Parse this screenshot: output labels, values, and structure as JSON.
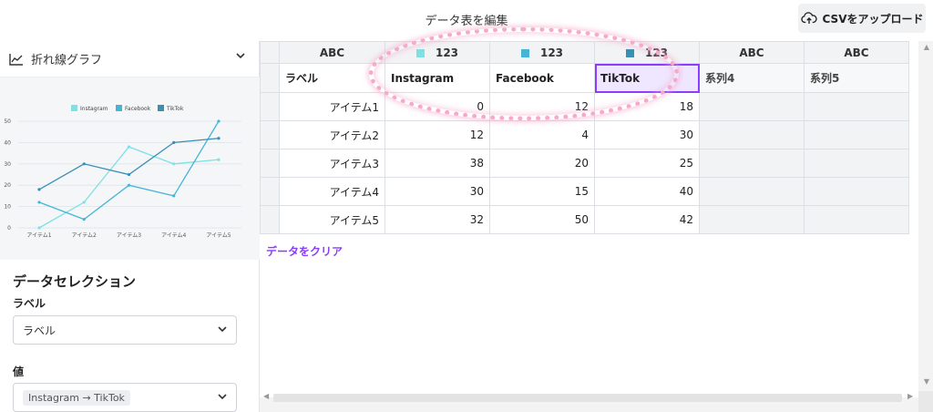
{
  "header": {
    "title": "データ表を編集",
    "csv_button": "CSVをアップロード"
  },
  "sidebar": {
    "chart_type": "折れ線グラフ",
    "section_title": "データセレクション",
    "label_title": "ラベル",
    "label_value": "ラベル",
    "value_title": "値",
    "value_value": "Instagram → TikTok"
  },
  "grid": {
    "type_labels": [
      "ABC",
      "123",
      "123",
      "123",
      "ABC",
      "ABC"
    ],
    "headers": [
      "ラベル",
      "Instagram",
      "Facebook",
      "TikTok",
      "系列4",
      "系列5"
    ],
    "rows": [
      [
        "アイテム1",
        "0",
        "12",
        "18"
      ],
      [
        "アイテム2",
        "12",
        "4",
        "30"
      ],
      [
        "アイテム3",
        "38",
        "20",
        "25"
      ],
      [
        "アイテム4",
        "30",
        "15",
        "40"
      ],
      [
        "アイテム5",
        "32",
        "50",
        "42"
      ]
    ],
    "clear_link": "データをクリア"
  },
  "colors": {
    "instagram": "#7fe0e6",
    "facebook": "#45b5d6",
    "tiktok": "#3a8fb5",
    "accent": "#8b3dff",
    "highlight": "#f6a9c9"
  },
  "chart_data": {
    "type": "line",
    "categories": [
      "アイテム1",
      "アイテム2",
      "アイテム3",
      "アイテム4",
      "アイテム5"
    ],
    "series": [
      {
        "name": "Instagram",
        "values": [
          0,
          12,
          38,
          30,
          32
        ]
      },
      {
        "name": "Facebook",
        "values": [
          12,
          4,
          20,
          15,
          50
        ]
      },
      {
        "name": "TikTok",
        "values": [
          18,
          30,
          25,
          40,
          42
        ]
      }
    ],
    "y_ticks": [
      "0",
      "10",
      "20",
      "30",
      "40",
      "50"
    ],
    "ylim": [
      0,
      50
    ],
    "legend_position": "top",
    "grid": true
  }
}
